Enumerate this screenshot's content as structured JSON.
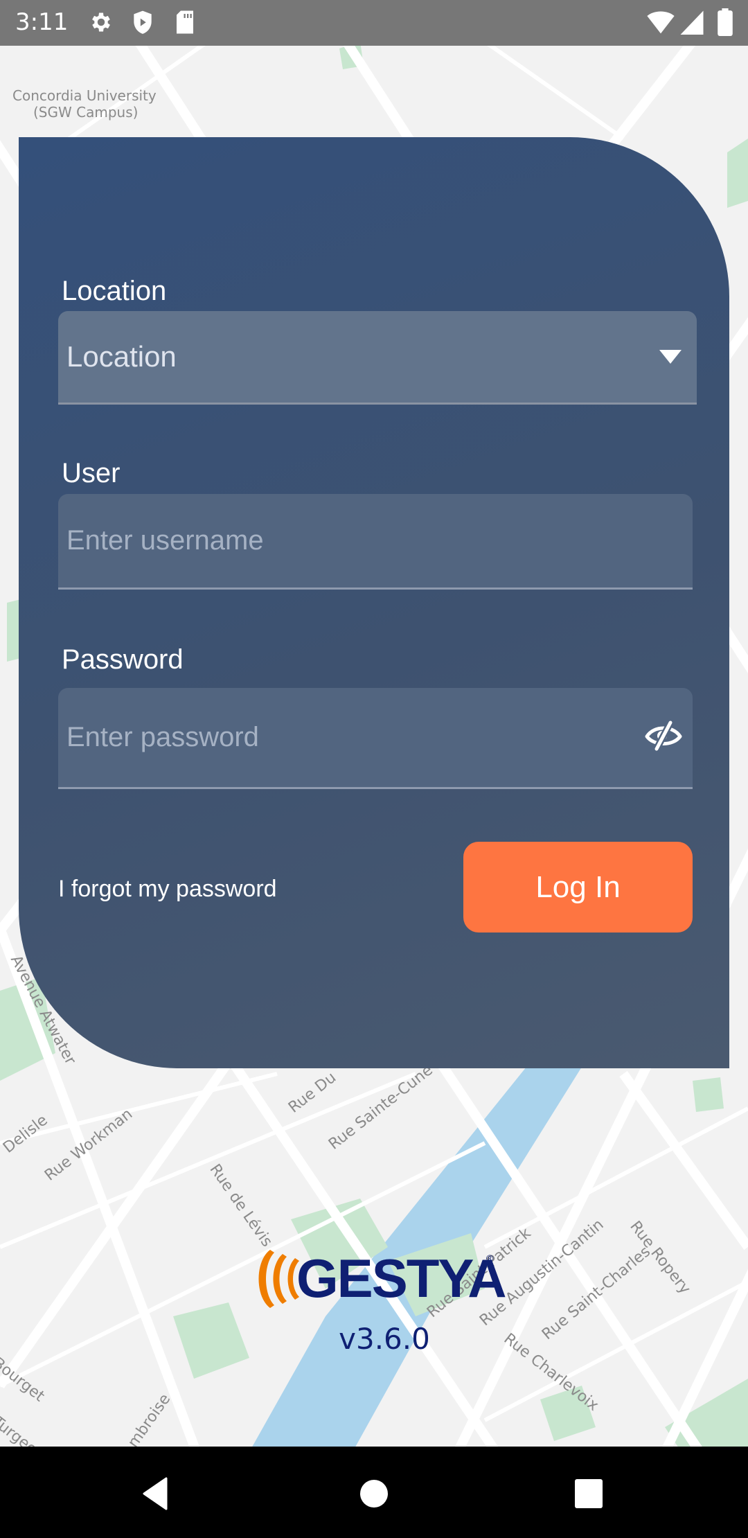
{
  "status_bar": {
    "time": "3:11",
    "left_icons": [
      "settings-icon",
      "shield-play-icon",
      "sd-card-icon"
    ],
    "right_icons": [
      "wifi-icon",
      "cell-signal-icon",
      "battery-icon"
    ]
  },
  "map": {
    "labels": [
      "Concordia University",
      "(SGW Campus)",
      "Rue Workman",
      "Delisle",
      "Rue de Lévis",
      "Rue Du",
      "Rue Sainte-Cune",
      "Avenue Atwater",
      "Rue Saint-Patrick",
      "Rue Augustin-Cantin",
      "Rue Saint-Charles",
      "Rue Ropery",
      "Rue Charlevoix",
      "Bourget",
      "Turgeon",
      "mbroise"
    ],
    "colors": {
      "land": "#f2f2f2",
      "road": "#ffffff",
      "park": "#c8e6cf",
      "water": "#aad3ec"
    }
  },
  "login_form": {
    "location_label": "Location",
    "location_select": {
      "selected": "Location"
    },
    "user_label": "User",
    "user_input": {
      "value": "",
      "placeholder": "Enter username"
    },
    "password_label": "Password",
    "password_input": {
      "value": "",
      "placeholder": "Enter password"
    },
    "password_toggle_icon": "eye-off-icon",
    "forgot_password_link": "I forgot my password",
    "login_button": "Log In"
  },
  "branding": {
    "logo_text": "GESTYA",
    "logo_registered": "®",
    "version": "v3.6.0",
    "colors": {
      "primary": "#0f2073",
      "accent": "#ef7d00",
      "button": "#fe7541",
      "card": "#3b5272"
    }
  },
  "nav_bar": {
    "buttons": [
      "back",
      "home",
      "recents"
    ]
  }
}
